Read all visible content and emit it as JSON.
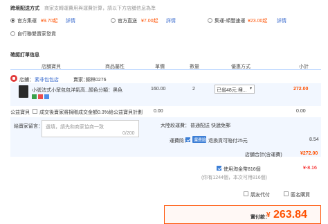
{
  "shipping": {
    "title": "跨境配送方式",
    "subtitle": "商家支轉運費用與運費計算，請以下方店舖信息為準",
    "options": [
      {
        "label": "官方集運",
        "price": "¥9.70起",
        "link": "詳情",
        "selected": true
      },
      {
        "label": "官方直送",
        "price": "¥7.00起",
        "link": "詳情",
        "selected": false
      },
      {
        "label": "集運-順豐速運",
        "price": "¥23.00起",
        "link": "詳情",
        "selected": false
      },
      {
        "label": "自行聯繫賣家發貨",
        "selected": false
      }
    ]
  },
  "order": {
    "title": "確認訂單信息",
    "columns": [
      "店舖寶貝",
      "商品屬性",
      "單價",
      "數量",
      "優惠方式",
      "小計"
    ],
    "store": {
      "label": "店鋪：",
      "name": "素非包包店",
      "seller_label": "賣家：",
      "seller": "錦林0276"
    },
    "item": {
      "name": "小號法式小眾包包洋氣高...",
      "attr": "顏色分類：黑色",
      "price": "160.00",
      "qty": "2",
      "discount": "已省48元:埋...",
      "subtotal": "272.00"
    },
    "charity": {
      "label": "公益寶貝",
      "text": "成交後賣家將捐贈成交金額0.3%給公益寶貝計劃",
      "amount": "0.00",
      "right": "0.00"
    },
    "message": {
      "label": "給賣家留言：",
      "placeholder": "選填，請先和商家協商一致",
      "count": "0/200"
    },
    "delivery": {
      "label": "大陸段運費：",
      "value": "普通配送 快遞免郵",
      "insurance_label": "運費險：",
      "insurance_tag": "運費險",
      "insurance_text": "退換貨可賠付25元",
      "insurance_amount": "8.54"
    },
    "store_total": {
      "label": "店舖合計(含運費)",
      "value": "¥272.00"
    }
  },
  "points": {
    "label": "使用淘金幣816個",
    "sub": "(你有1244個，本次可用816個)",
    "value": "¥-8.16"
  },
  "options": {
    "anon": "朋友代付",
    "anon2": "匿名購買"
  },
  "payment": {
    "label": "實付款：",
    "currency": "¥",
    "amount": "263.84"
  },
  "colors": {
    "accent": "#ff5000",
    "blue": "#3d7fd6",
    "link": "#3366cc"
  }
}
